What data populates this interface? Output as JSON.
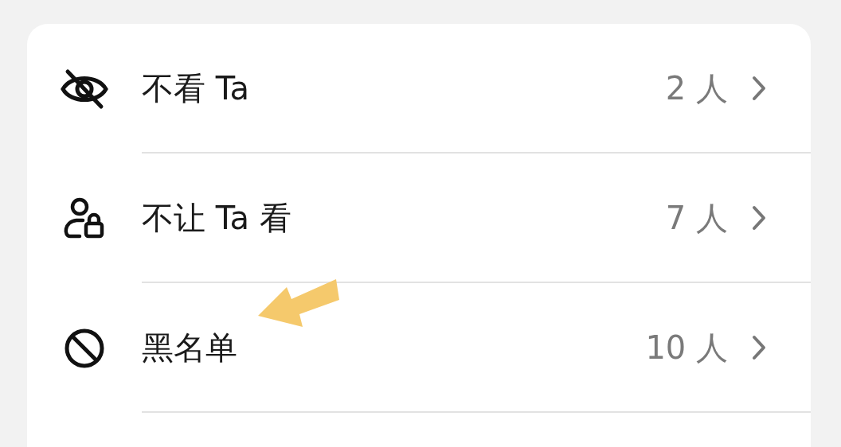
{
  "items": [
    {
      "kind": "hidden",
      "label": "不看 Ta",
      "count": "2 人"
    },
    {
      "kind": "locked",
      "label": "不让 Ta 看",
      "count": "7 人"
    },
    {
      "kind": "blocked",
      "label": "黑名单",
      "count": "10 人"
    }
  ]
}
